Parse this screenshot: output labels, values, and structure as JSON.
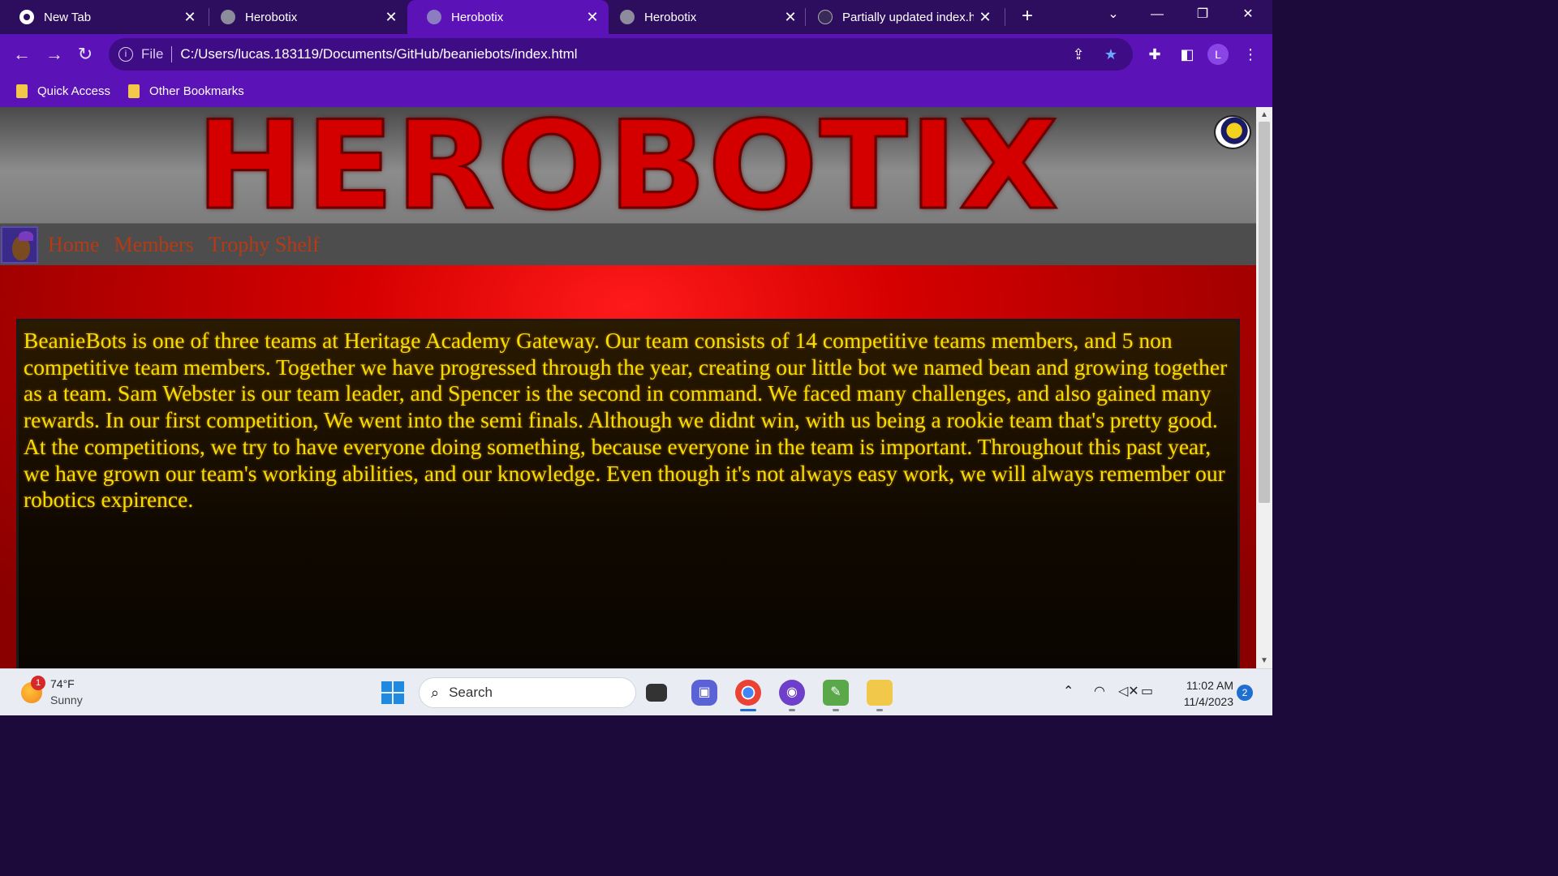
{
  "browser": {
    "tabs": [
      {
        "title": "New Tab",
        "favicon": "chrome-icon",
        "active": false
      },
      {
        "title": "Herobotix",
        "favicon": "globe-icon",
        "active": false
      },
      {
        "title": "Herobotix",
        "favicon": "globe-icon",
        "active": true
      },
      {
        "title": "Herobotix",
        "favicon": "globe-icon",
        "active": false
      },
      {
        "title": "Partially updated index.h",
        "favicon": "github-icon",
        "active": false
      }
    ],
    "address": {
      "scheme_label": "File",
      "url": "C:/Users/lucas.183119/Documents/GitHub/beaniebots/index.html"
    },
    "profile_initial": "L",
    "bookmarks": [
      {
        "label": "Quick Access"
      },
      {
        "label": "Other Bookmarks"
      }
    ],
    "colors": {
      "tabstrip": "#2c0d5e",
      "toolbar": "#5b13b8",
      "omnibox": "#3e0d85"
    }
  },
  "page": {
    "banner_title": "HEROBOTIX",
    "nav_links": [
      "Home",
      "Members",
      "Trophy Shelf"
    ],
    "body_text": "BeanieBots is one of three teams at Heritage Academy Gateway. Our team consists of 14 competitive teams members, and 5 non competitive team members. Together we have progressed through the year, creating our little bot we named bean and growing together as a team. Sam Webster is our team leader, and Spencer is the second in command. We faced many challenges, and also gained many rewards. In our first competition, We went into the semi finals. Although we didnt win, with us being a rookie team that's pretty good. At the competitions, we try to have everyone doing something, because everyone in the team is important. Throughout this past year, we have grown our team's working abilities, and our knowledge. Even though it's not always easy work, we will always remember our robotics expirence.",
    "colors": {
      "title_red": "#d40000",
      "nav_link": "#b53a16",
      "body_text": "#f0e000"
    }
  },
  "taskbar": {
    "weather": {
      "temp": "74°F",
      "condition": "Sunny",
      "badge": "1"
    },
    "search_placeholder": "Search",
    "clock": {
      "time": "11:02 AM",
      "date": "11/4/2023"
    },
    "notification_count": "2"
  }
}
